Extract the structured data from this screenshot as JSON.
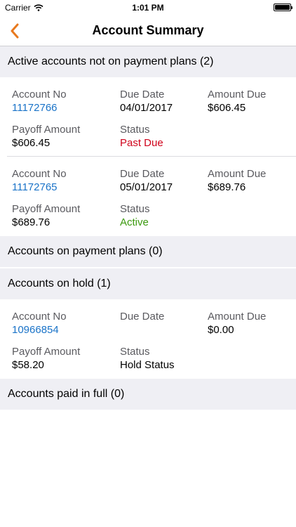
{
  "status_bar": {
    "carrier": "Carrier",
    "time": "1:01 PM"
  },
  "nav": {
    "title": "Account Summary",
    "back_icon": "chevron-left-icon",
    "accent_color": "#e8791e"
  },
  "labels": {
    "account_no": "Account No",
    "due_date": "Due Date",
    "amount_due": "Amount Due",
    "payoff_amount": "Payoff Amount",
    "status": "Status"
  },
  "sections": [
    {
      "title": "Active accounts not on payment plans (2)",
      "accounts": [
        {
          "account_no": "11172766",
          "due_date": "04/01/2017",
          "amount_due": "$606.45",
          "payoff_amount": "$606.45",
          "status": "Past Due",
          "status_color": "#d0021b"
        },
        {
          "account_no": "11172765",
          "due_date": "05/01/2017",
          "amount_due": "$689.76",
          "payoff_amount": "$689.76",
          "status": "Active",
          "status_color": "#3c9a10"
        }
      ]
    },
    {
      "title": "Accounts on payment plans (0)",
      "accounts": []
    },
    {
      "title": "Accounts on hold (1)",
      "accounts": [
        {
          "account_no": "10966854",
          "due_date": "",
          "amount_due": "$0.00",
          "payoff_amount": "$58.20",
          "status": "Hold Status",
          "status_color": "#000000"
        }
      ]
    },
    {
      "title": "Accounts paid in full (0)",
      "accounts": []
    }
  ]
}
